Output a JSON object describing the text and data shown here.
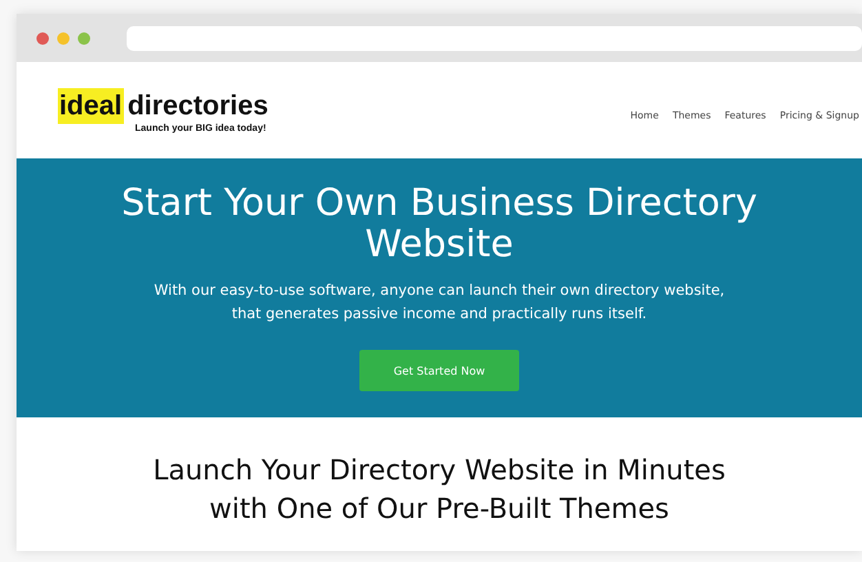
{
  "logo": {
    "highlight": "ideal",
    "word": "directories",
    "tagline": "Launch your BIG idea today!"
  },
  "nav": [
    {
      "label": "Home"
    },
    {
      "label": "Themes"
    },
    {
      "label": "Features"
    },
    {
      "label": "Pricing & Signup"
    }
  ],
  "hero": {
    "title": "Start Your Own Business Directory Website",
    "subtitle": "With our easy-to-use software, anyone can launch their own directory website, that generates passive income and practically runs itself.",
    "button": "Get Started Now"
  },
  "section": {
    "heading": "Launch Your Directory Website in Minutes with One of Our Pre-Built Themes"
  }
}
